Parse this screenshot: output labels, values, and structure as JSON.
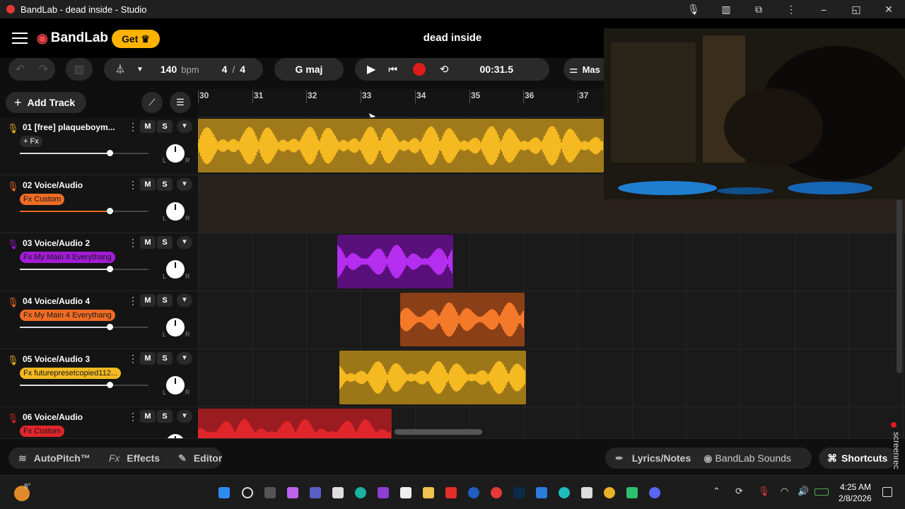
{
  "window": {
    "title": "BandLab - dead inside - Studio",
    "controls": [
      "⎯",
      "◱",
      "✕"
    ]
  },
  "header": {
    "logo": "BandLab",
    "get_label": "Get",
    "project_title": "dead inside"
  },
  "toolbar": {
    "bpm_value": "140",
    "bpm_unit": "bpm",
    "time_sig_num": "4",
    "time_sig_sep": "/",
    "time_sig_den": "4",
    "key": "G maj",
    "time": "00:31.5",
    "master_label": "Mas"
  },
  "tracks_header": {
    "add_track_label": "Add Track"
  },
  "ruler": {
    "bars": [
      "30",
      "31",
      "32",
      "33",
      "34",
      "35",
      "36",
      "37"
    ]
  },
  "tracks": [
    {
      "name": "01 [free] plaqueboym...",
      "fx": "+ Fx",
      "color": "#f5b921",
      "fx_bg": "#2a2a2a",
      "fx_fg": "#fff",
      "volume": 0.7,
      "m": "M",
      "s": "S",
      "l": "L",
      "r": "R"
    },
    {
      "name": "02 Voice/Audio",
      "fx": "Fx Custom",
      "color": "#ef6c24",
      "fx_bg": "#ef6c24",
      "fx_fg": "#1a1a1a",
      "volume": 0.7,
      "m": "M",
      "s": "S",
      "l": "L",
      "r": "R"
    },
    {
      "name": "03 Voice/Audio 2",
      "fx": "Fx My Main 4 Everythang",
      "color": "#a21bd6",
      "fx_bg": "#a21bd6",
      "fx_fg": "#1a1a1a",
      "volume": 0.7,
      "m": "M",
      "s": "S",
      "l": "L",
      "r": "R"
    },
    {
      "name": "04 Voice/Audio 4",
      "fx": "Fx My Main 4 Everythang",
      "color": "#ef6c24",
      "fx_bg": "#ef6c24",
      "fx_fg": "#1a1a1a",
      "volume": 0.7,
      "m": "M",
      "s": "S",
      "l": "L",
      "r": "R"
    },
    {
      "name": "05 Voice/Audio 3",
      "fx": "Fx futurepresetcopied112...",
      "color": "#f5b921",
      "fx_bg": "#f5b921",
      "fx_fg": "#1a1a1a",
      "volume": 0.7,
      "m": "M",
      "s": "S",
      "l": "L",
      "r": "R"
    },
    {
      "name": "06 Voice/Audio",
      "fx": "Fx Custom",
      "color": "#e0262b",
      "fx_bg": "#e0262b",
      "fx_fg": "#1a1a1a",
      "volume": 0.7,
      "m": "M",
      "s": "S",
      "l": "L",
      "r": "R"
    }
  ],
  "bottombar": {
    "autopitch": "AutoPitch™",
    "effects_prefix": "Fx",
    "effects": "Effects",
    "editor": "Editor",
    "lyrics": "Lyrics/Notes",
    "sounds": "BandLab Sounds",
    "shortcuts": "Shortcuts",
    "screenrec": "screenrec"
  },
  "taskbar": {
    "temp": "8°",
    "time": "4:25 AM",
    "date": "2/8/2026"
  }
}
